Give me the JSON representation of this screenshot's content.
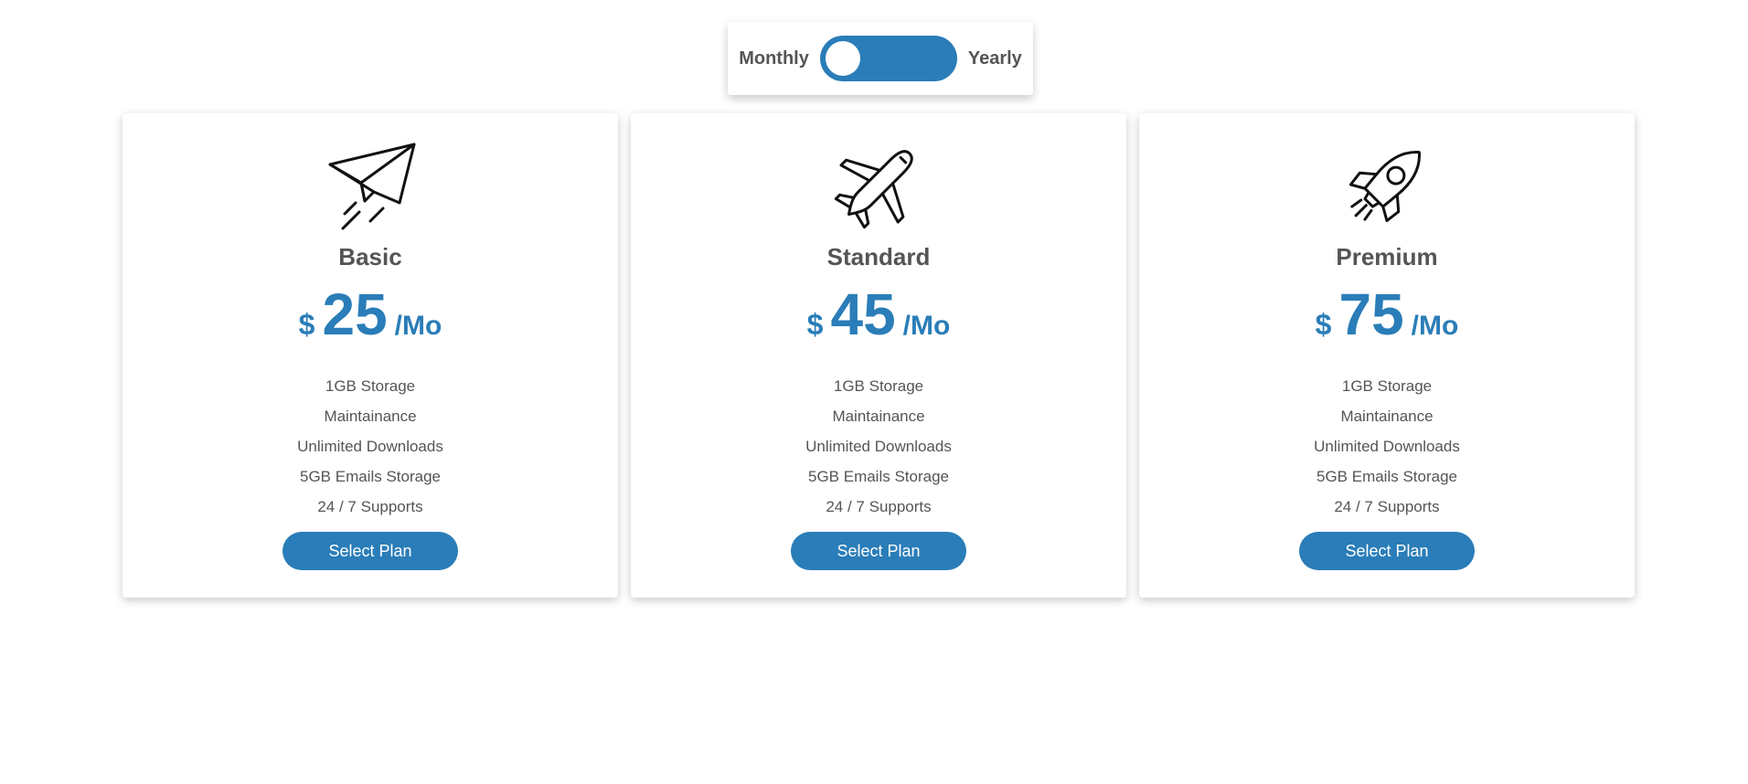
{
  "billing_toggle": {
    "left_label": "Monthly",
    "right_label": "Yearly",
    "selected": "Monthly"
  },
  "accent_color": "#2a7db8",
  "plans": [
    {
      "icon": "paper-plane-icon",
      "name": "Basic",
      "currency": "$",
      "amount": "25",
      "period": "/Mo",
      "features": [
        "1GB Storage",
        "Maintainance",
        "Unlimited Downloads",
        "5GB Emails Storage",
        "24 / 7 Supports"
      ],
      "button_label": "Select Plan"
    },
    {
      "icon": "airplane-icon",
      "name": "Standard",
      "currency": "$",
      "amount": "45",
      "period": "/Mo",
      "features": [
        "1GB Storage",
        "Maintainance",
        "Unlimited Downloads",
        "5GB Emails Storage",
        "24 / 7 Supports"
      ],
      "button_label": "Select Plan"
    },
    {
      "icon": "rocket-icon",
      "name": "Premium",
      "currency": "$",
      "amount": "75",
      "period": "/Mo",
      "features": [
        "1GB Storage",
        "Maintainance",
        "Unlimited Downloads",
        "5GB Emails Storage",
        "24 / 7 Supports"
      ],
      "button_label": "Select Plan"
    }
  ]
}
